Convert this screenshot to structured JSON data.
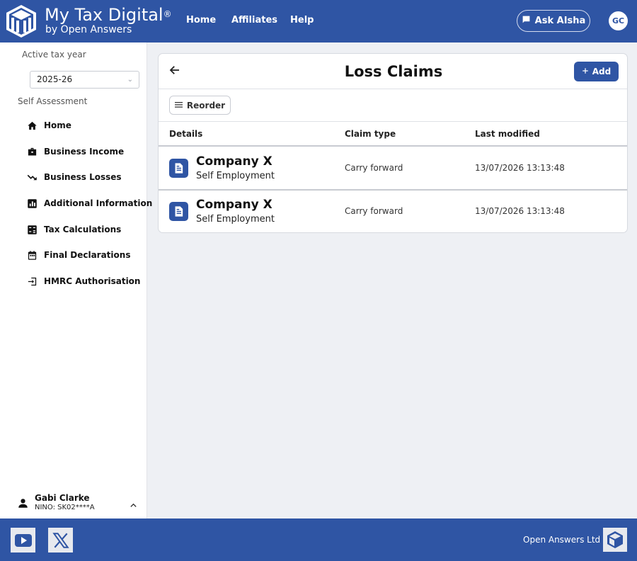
{
  "header": {
    "brand_title": "My Tax Digital",
    "brand_mark": "®",
    "brand_sub": "by Open Answers",
    "nav": [
      {
        "label": "Home"
      },
      {
        "label": "Affiliates"
      },
      {
        "label": "Help"
      }
    ],
    "ask_label": "Ask AIsha",
    "avatar_initials": "GC"
  },
  "sidebar": {
    "tax_year_label": "Active tax year",
    "tax_year_value": "2025-26",
    "section_label": "Self Assessment",
    "items": [
      {
        "label": "Home",
        "icon": "home-icon"
      },
      {
        "label": "Business Income",
        "icon": "briefcase-icon"
      },
      {
        "label": "Business Losses",
        "icon": "trending-down-icon"
      },
      {
        "label": "Additional Information",
        "icon": "bar-chart-icon"
      },
      {
        "label": "Tax Calculations",
        "icon": "calculator-icon"
      },
      {
        "label": "Final Declarations",
        "icon": "calendar-icon"
      },
      {
        "label": "HMRC Authorisation",
        "icon": "login-icon"
      }
    ],
    "user": {
      "name": "Gabi Clarke",
      "nino": "NINO: SK02****A"
    }
  },
  "main": {
    "title": "Loss Claims",
    "add_label": "Add",
    "reorder_label": "Reorder",
    "columns": [
      "Details",
      "Claim type",
      "Last modified"
    ],
    "rows": [
      {
        "title": "Company X",
        "subtitle": "Self Employment",
        "claim_type": "Carry forward",
        "last_modified": "13/07/2026 13:13:48"
      },
      {
        "title": "Company X",
        "subtitle": "Self Employment",
        "claim_type": "Carry forward",
        "last_modified": "13/07/2026 13:13:48"
      }
    ]
  },
  "footer": {
    "company": "Open Answers Ltd"
  },
  "colors": {
    "brand": "#2f55a4",
    "background": "#eef0f4"
  }
}
